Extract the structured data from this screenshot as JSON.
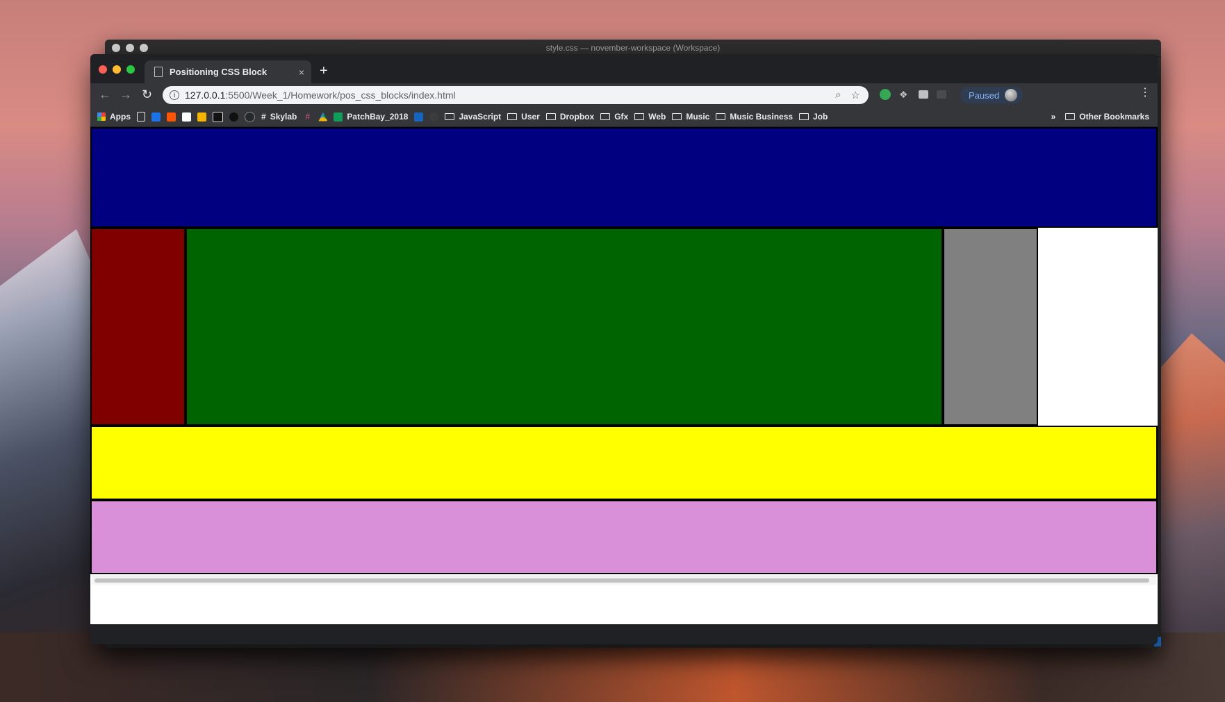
{
  "editor_window": {
    "title": "style.css — november-workspace (Workspace)"
  },
  "browser": {
    "tab": {
      "title": "Positioning CSS Block",
      "close_glyph": "×"
    },
    "new_tab_glyph": "+",
    "toolbar": {
      "back_glyph": "←",
      "forward_glyph": "→",
      "reload_glyph": "↻",
      "url_host": "127.0.0.1",
      "url_path": ":5500/Week_1/Homework/pos_css_blocks/index.html",
      "zoom_glyph": "⌕",
      "star_glyph": "☆",
      "profile_status": "Paused",
      "menu_glyph": "⋮"
    },
    "bookmarks": {
      "apps": "Apps",
      "skylab_prefix": "#",
      "skylab": "Skylab",
      "patchbay": "PatchBay_2018",
      "javascript": "JavaScript",
      "user": "User",
      "dropbox": "Dropbox",
      "gfx": "Gfx",
      "web": "Web",
      "music": "Music",
      "music_business": "Music Business",
      "job": "Job",
      "overflow": "»",
      "other": "Other Bookmarks"
    }
  },
  "page": {
    "colors": {
      "header": "#000080",
      "left_column": "#800000",
      "main": "#006400",
      "right_column": "#808080",
      "yellow_band": "#ffff00",
      "footer": "#da90d8"
    }
  }
}
